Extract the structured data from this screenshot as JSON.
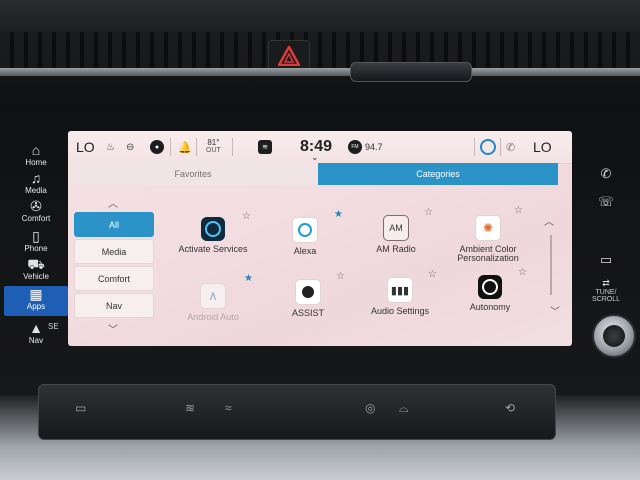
{
  "status": {
    "temp_left": "LO",
    "outside_temp": "81°",
    "outside_label": "OUT",
    "time": "8:49",
    "radio_badge": "FM",
    "radio_freq": "94.7",
    "temp_right": "LO"
  },
  "tabs": {
    "favorites": "Favorites",
    "categories": "Categories"
  },
  "categories": [
    "All",
    "Media",
    "Comfort",
    "Nav"
  ],
  "apps": {
    "row1": [
      {
        "label": "Activate Services",
        "star": "outline"
      },
      {
        "label": "Alexa",
        "star": "filled"
      },
      {
        "label": "AM Radio",
        "icon_text": "AM",
        "star": "outline"
      },
      {
        "label": "Ambient Color Personalization",
        "star": "outline"
      }
    ],
    "row2": [
      {
        "label": "Android Auto",
        "star": "filled"
      },
      {
        "label": "ASSIST",
        "star": "outline"
      },
      {
        "label": "Audio Settings",
        "star": "outline"
      },
      {
        "label": "Autonomy",
        "star": "outline"
      }
    ]
  },
  "left_buttons": {
    "home": "Home",
    "media": "Media",
    "comfort": "Comfort",
    "phone": "Phone",
    "vehicle": "Vehicle",
    "apps": "Apps",
    "nav": "Nav",
    "nav_dir": "SE"
  },
  "right_buttons": {
    "tune": "TUNE/",
    "scroll": "SCROLL"
  },
  "colors": {
    "accent": "#2b93c8",
    "apps_active": "#1e5fb5"
  }
}
